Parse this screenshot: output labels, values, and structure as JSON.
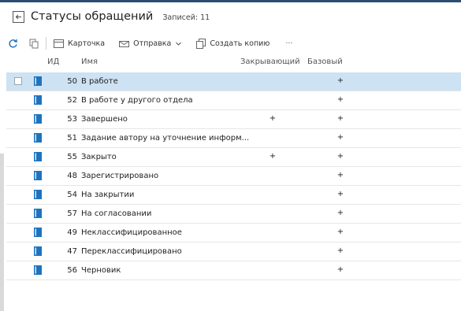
{
  "header": {
    "title": "Статусы обращений",
    "count_label": "Записей:",
    "count_value": "11"
  },
  "toolbar": {
    "card_label": "Карточка",
    "send_label": "Отправка",
    "copy_label": "Создать копию",
    "more_label": "···"
  },
  "columns": {
    "id": "ИД",
    "name": "Имя",
    "closing": "Закрывающий",
    "base": "Базовый"
  },
  "rows": [
    {
      "id": "50",
      "name": "В работе",
      "closing": "",
      "base": "+"
    },
    {
      "id": "52",
      "name": "В работе у другого отдела",
      "closing": "",
      "base": "+"
    },
    {
      "id": "53",
      "name": "Завершено",
      "closing": "+",
      "base": "+"
    },
    {
      "id": "51",
      "name": "Задание автору на уточнение информ...",
      "closing": "",
      "base": "+"
    },
    {
      "id": "55",
      "name": "Закрыто",
      "closing": "+",
      "base": "+"
    },
    {
      "id": "48",
      "name": "Зарегистрировано",
      "closing": "",
      "base": "+"
    },
    {
      "id": "54",
      "name": "На закрытии",
      "closing": "",
      "base": "+"
    },
    {
      "id": "57",
      "name": "На согласовании",
      "closing": "",
      "base": "+"
    },
    {
      "id": "49",
      "name": "Неклассифицированное",
      "closing": "",
      "base": "+"
    },
    {
      "id": "47",
      "name": "Переклассифицировано",
      "closing": "",
      "base": "+"
    },
    {
      "id": "56",
      "name": "Черновик",
      "closing": "",
      "base": "+"
    }
  ],
  "icons": {
    "back": "back-arrow-icon",
    "refresh": "refresh-icon",
    "copy": "copy-icon",
    "card": "card-icon",
    "send": "send-icon",
    "dropdown": "chevron-down-icon",
    "create_copy": "create-copy-icon",
    "row": "document-icon"
  },
  "colors": {
    "accent": "#1e73be",
    "selected_row": "#cde2f3",
    "top_strip": "#2c4d72"
  }
}
